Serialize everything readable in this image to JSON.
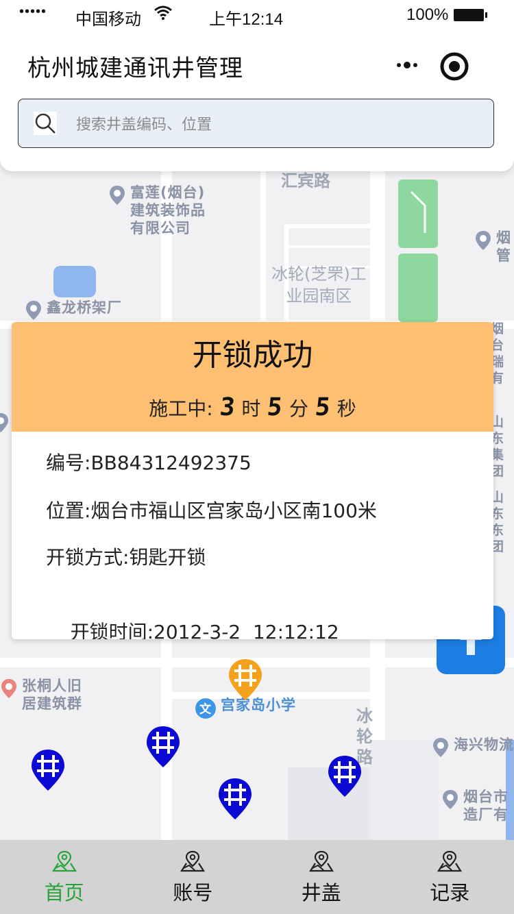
{
  "status_bar": {
    "signal": "•••••",
    "carrier": "中国移动",
    "time": "上午12:14",
    "battery": "100%"
  },
  "header": {
    "title": "杭州城建通讯井管理",
    "more_icon": "more-dots-icon",
    "target_icon": "target-icon"
  },
  "search": {
    "placeholder": "搜索井盖编码、位置",
    "icon": "search-icon"
  },
  "map": {
    "labels": {
      "road_top": "汇宾路",
      "poi_fulian": [
        "富莲(烟台)",
        "建筑装饰品",
        "有限公司"
      ],
      "area_binglun": [
        "冰轮(芝罘)工",
        "业园南区"
      ],
      "poi_xinlong": "鑫龙桥架厂",
      "poi_yan_guan": [
        "烟",
        "管"
      ],
      "poi_zhangtong": [
        "张桐人旧",
        "居建筑群"
      ],
      "poi_gongjiadao_school": "宫家岛小学",
      "road_binglun": "冰轮路",
      "poi_haixing": "海兴物流",
      "poi_yantai_zaochuan": [
        "烟台市",
        "造厂有"
      ],
      "right_edge": [
        "烟台",
        "瑞有",
        "山东",
        "集团",
        "山东",
        "东团"
      ]
    },
    "colors": {
      "marker_active": "#f4a21c",
      "marker_normal": "#0a0ad4",
      "park_green": "#8ed8a0",
      "water_blue": "#8fb6ef"
    }
  },
  "unlock_card": {
    "title": "开锁成功",
    "timer": {
      "prefix": "施工中:",
      "hours": "3",
      "hours_unit": "时",
      "minutes": "5",
      "minutes_unit": "分",
      "seconds": "5",
      "seconds_unit": "秒"
    },
    "fields": [
      {
        "label": "编号:",
        "value": "BB84312492375"
      },
      {
        "label": "位置:",
        "value": "烟台市福山区宫家岛小区南100米"
      },
      {
        "label": "开锁方式:",
        "value": "钥匙开锁"
      },
      {
        "label": "开锁时间:",
        "value": "2012-3-2  12:12:12"
      }
    ],
    "accent": "#fdc072"
  },
  "tabbar": {
    "tabs": [
      {
        "label": "首页",
        "icon": "map-pin-icon",
        "active": true
      },
      {
        "label": "账号",
        "icon": "map-pin-icon",
        "active": false
      },
      {
        "label": "井盖",
        "icon": "map-pin-icon",
        "active": false
      },
      {
        "label": "记录",
        "icon": "map-pin-icon",
        "active": false
      }
    ],
    "active_color": "#27a33a"
  }
}
